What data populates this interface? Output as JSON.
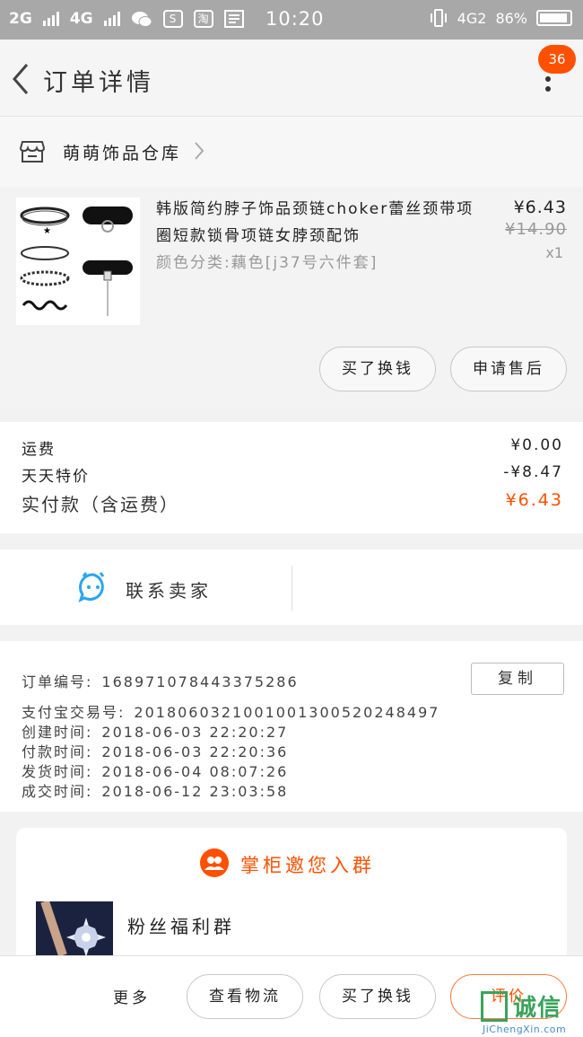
{
  "status_bar": {
    "net1": "2G",
    "net2": "4G",
    "time": "10:20",
    "net3": "4G2",
    "battery": "86%"
  },
  "nav": {
    "title": "订单详情",
    "badge": "36"
  },
  "store": {
    "name": "萌萌饰品仓库"
  },
  "product": {
    "title": "韩版简约脖子饰品颈链choker蕾丝颈带项圈短款锁骨项链女脖颈配饰",
    "sku": "颜色分类:藕色[j37号六件套]",
    "price": "¥6.43",
    "original_price": "¥14.90",
    "quantity": "x1",
    "btn_buy_again": "买了换钱",
    "btn_aftersale": "申请售后"
  },
  "fees": {
    "shipping_label": "运费",
    "shipping_value": "¥0.00",
    "discount_label": "天天特价",
    "discount_value": "-¥8.47",
    "total_label": "实付款（含运费）",
    "total_value": "¥6.43"
  },
  "contact": {
    "label": "联系卖家"
  },
  "order_info": {
    "order_no_label": "订单编号:",
    "order_no": "168971078443375286",
    "copy_label": "复制",
    "alipay_label": "支付宝交易号:",
    "alipay_no": "2018060321001001300520248497",
    "created_label": "创建时间:",
    "created": "2018-06-03 22:20:27",
    "paid_label": "付款时间:",
    "paid": "2018-06-03 22:20:36",
    "shipped_label": "发货时间:",
    "shipped": "2018-06-04 08:07:26",
    "completed_label": "成交时间:",
    "completed": "2018-06-12 23:03:58"
  },
  "group": {
    "header": "掌柜邀您入群",
    "name": "粉丝福利群"
  },
  "bottom_bar": {
    "more": "更多",
    "logistics": "查看物流",
    "buy_again": "买了换钱",
    "review": "评价"
  },
  "watermark": {
    "text": "诚信",
    "url": "JiChengXin.com"
  },
  "colors": {
    "accent": "#ff5000",
    "contact_icon": "#2aa5f0"
  }
}
